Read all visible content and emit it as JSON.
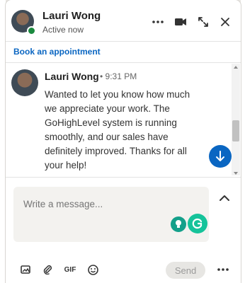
{
  "header": {
    "name": "Lauri Wong",
    "status": "Active now"
  },
  "banner": {
    "link": "Book an appointment"
  },
  "message": {
    "sender": "Lauri Wong",
    "time": "• 9:31 PM",
    "text": "Wanted to let you know how much we appreciate your work. The GoHighLevel system is running smoothly, and our sales have definitely improved. Thanks for all your help!"
  },
  "composer": {
    "placeholder": "Write a message..."
  },
  "toolbar": {
    "gif_label": "GIF",
    "send_label": "Send"
  },
  "colors": {
    "accent": "#0a66c2",
    "presence": "#1b8a3f",
    "grammarly": "#15c39a"
  }
}
